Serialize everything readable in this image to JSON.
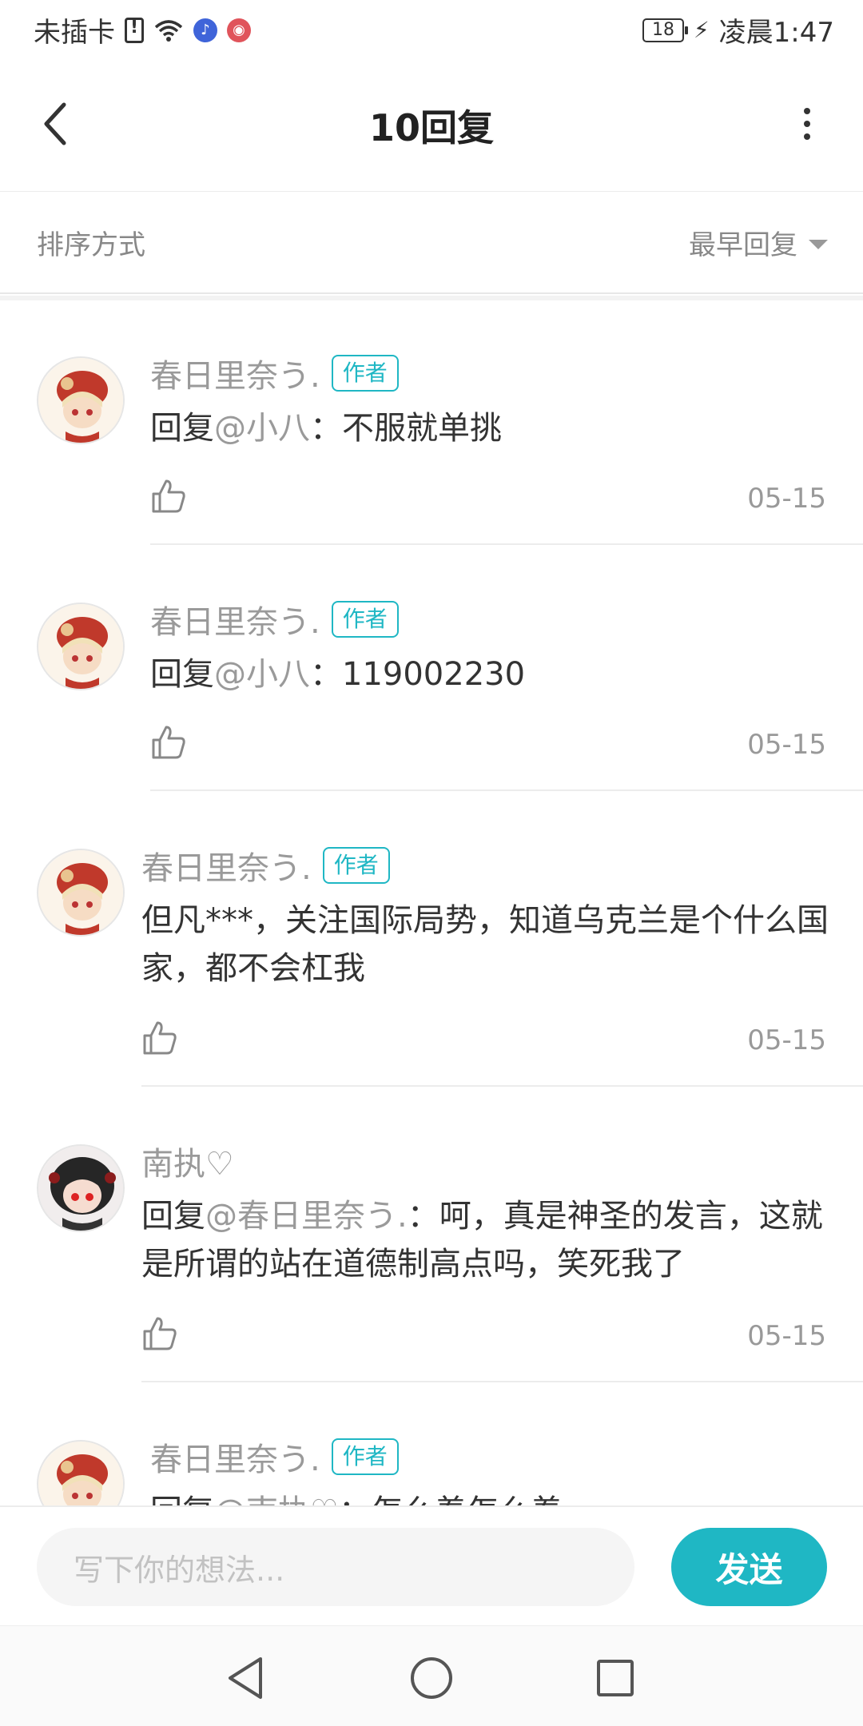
{
  "status_bar": {
    "carrier": "未插卡",
    "battery_level": "18",
    "time": "凌晨1:47"
  },
  "header": {
    "title": "10回复"
  },
  "sort": {
    "label": "排序方式",
    "selected": "最早回复"
  },
  "comments": [
    {
      "username": "春日里奈う.",
      "tag": "作者",
      "reply_prefix": "回复",
      "reply_to": "@小八",
      "text": "：不服就单挑",
      "date": "05-15",
      "avatar": "girl-red-hat"
    },
    {
      "username": "春日里奈う.",
      "tag": "作者",
      "reply_prefix": "回复",
      "reply_to": "@小八",
      "text": "：119002230",
      "date": "05-15",
      "avatar": "girl-red-hat"
    },
    {
      "username": "春日里奈う.",
      "tag": "作者",
      "reply_prefix": "",
      "reply_to": "",
      "text": "但凡***，关注国际局势，知道乌克兰是个什么国家，都不会杠我",
      "date": "05-15",
      "avatar": "girl-red-hat"
    },
    {
      "username": "南执♡",
      "tag": "",
      "reply_prefix": "回复",
      "reply_to": "@春日里奈う.",
      "text": "：呵，真是神圣的发言，这就是所谓的站在道德制高点吗，笑死我了",
      "date": "05-15",
      "avatar": "girl-black-hair"
    },
    {
      "username": "春日里奈う.",
      "tag": "作者",
      "reply_prefix": "回复",
      "reply_to": "@南执♡",
      "text": "：怎么着怎么着",
      "date": "",
      "avatar": "girl-red-hat"
    }
  ],
  "composer": {
    "placeholder": "写下你的想法...",
    "send_label": "发送"
  },
  "colors": {
    "accent": "#1fb7c4",
    "muted": "#9a9a9a",
    "text": "#333333"
  }
}
